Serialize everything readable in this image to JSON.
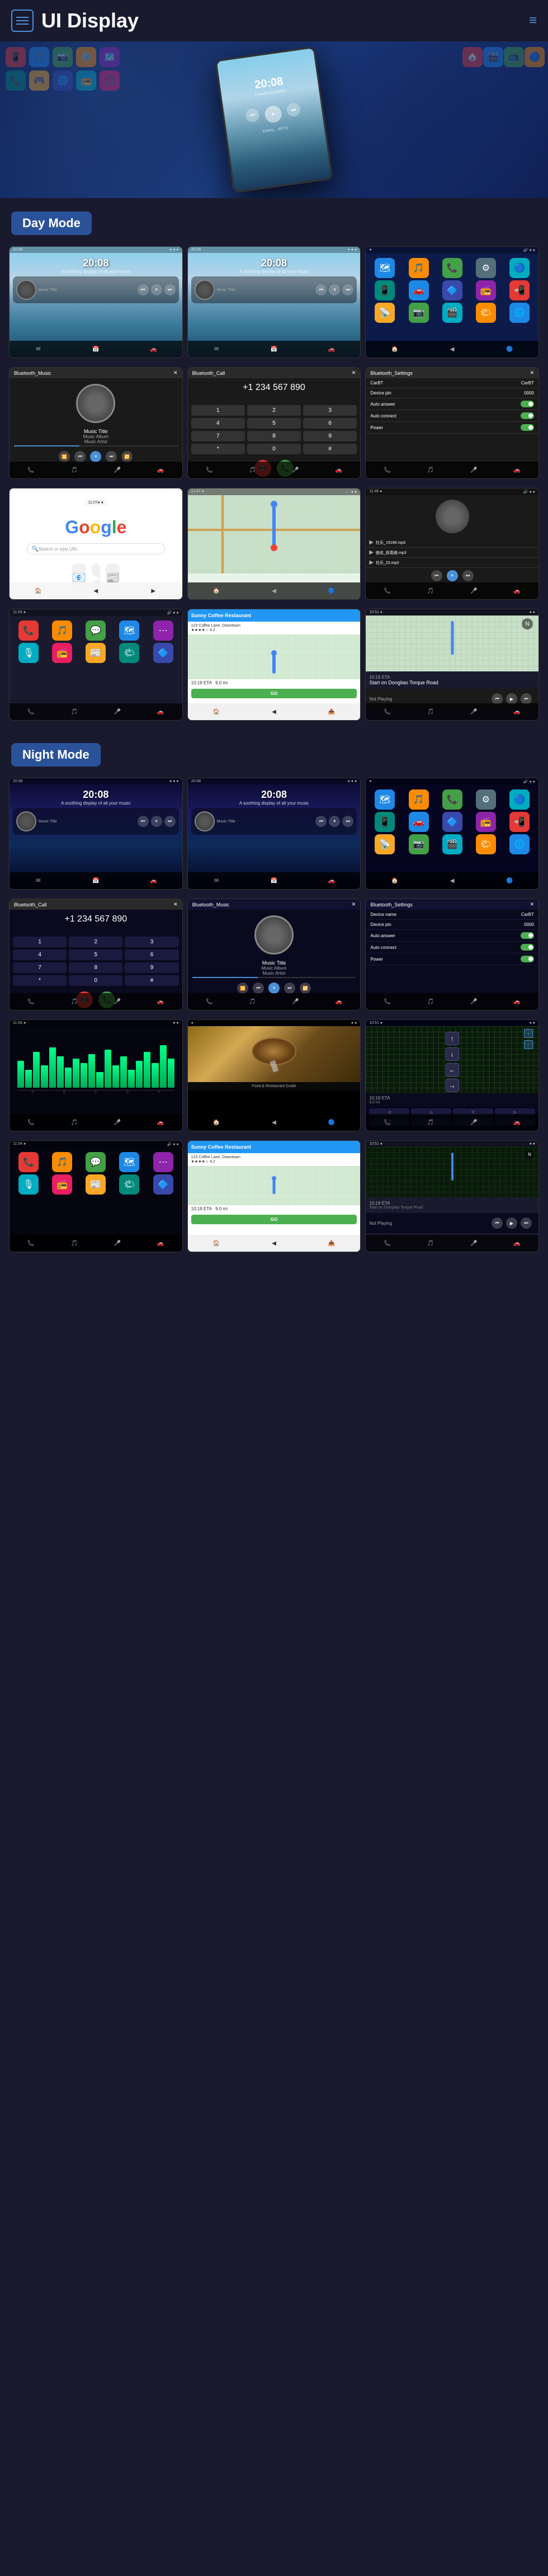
{
  "page": {
    "title": "UI Display",
    "brand": "≡"
  },
  "header": {
    "menu_label": "menu",
    "hamburger": "≡",
    "lines_icon": "≡"
  },
  "sections": {
    "day_mode": "Day Mode",
    "night_mode": "Night Mode"
  },
  "screens": {
    "home_time": "20:08",
    "home_subtitle": "A soothing display of all your music",
    "bluetooth_music": "Bluetooth_Music",
    "bluetooth_call": "Bluetooth_Call",
    "bluetooth_settings": "Bluetooth_Settings",
    "music_title": "Music Title",
    "music_album": "Music Album",
    "music_artist": "Music Artist",
    "device_name": "CarBT",
    "device_pin": "0000",
    "auto_answer": "Auto answer",
    "auto_connect": "Auto connect",
    "power": "Power",
    "sunny_coffee": "Sunny Coffee Restaurant",
    "go_label": "GO",
    "not_playing": "Not Playing",
    "eta_label": "10:19 ETA",
    "distance": "9.0 mi",
    "start_on": "Start on Dongliao Torque Road",
    "social_music_title": "社乐_19199.mp3",
    "app_icons": [
      "📱",
      "🎵",
      "📷",
      "⚙️",
      "🗺️",
      "📞",
      "🎮",
      "🌐",
      "📻",
      "🎧",
      "🏠",
      "🎬",
      "📺",
      "🔵",
      "🟢"
    ]
  }
}
